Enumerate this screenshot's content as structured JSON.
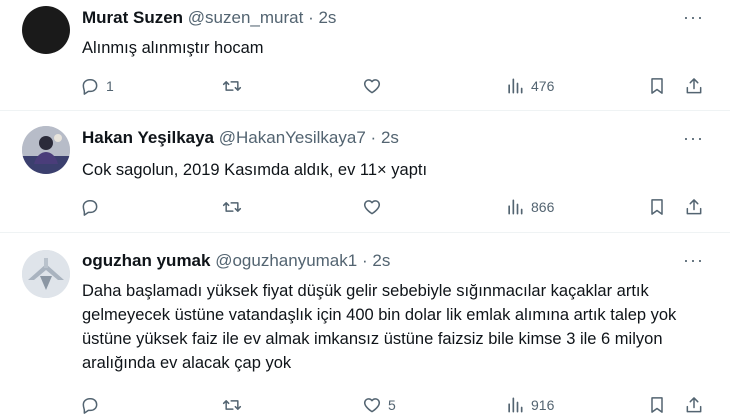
{
  "tweets": [
    {
      "name": "Murat Suzen",
      "handle": "@suzen_murat",
      "dot": "·",
      "time": "2s",
      "text": "Alınmış alınmıştır hocam",
      "replies": "1",
      "retweets": "",
      "likes": "",
      "views": "476"
    },
    {
      "name": "Hakan Yeşilkaya",
      "handle": "@HakanYesilkaya7",
      "dot": "·",
      "time": "2s",
      "text": "Cok sagolun, 2019 Kasımda aldık, ev 11× yaptı",
      "replies": "",
      "retweets": "",
      "likes": "",
      "views": "866"
    },
    {
      "name": "oguzhan yumak",
      "handle": "@oguzhanyumak1",
      "dot": "·",
      "time": "2s",
      "text": "Daha başlamadı yüksek fiyat düşük gelir sebebiyle sığınmacılar kaçaklar artık gelmeyecek üstüne vatandaşlık için 400 bin dolar lik emlak alımına artık talep yok üstüne yüksek faiz ile ev almak imkansız üstüne faizsiz bile kimse 3 ile 6 milyon aralığında ev alacak çap yok",
      "replies": "",
      "retweets": "",
      "likes": "5",
      "views": "916"
    }
  ],
  "more_label": "···",
  "icons": [
    "reply-icon",
    "retweet-icon",
    "like-icon",
    "views-icon",
    "bookmark-icon",
    "share-icon",
    "more-icon"
  ],
  "colors": {
    "text": "#0f1419",
    "secondary": "#536471",
    "divider": "#eff3f4"
  }
}
